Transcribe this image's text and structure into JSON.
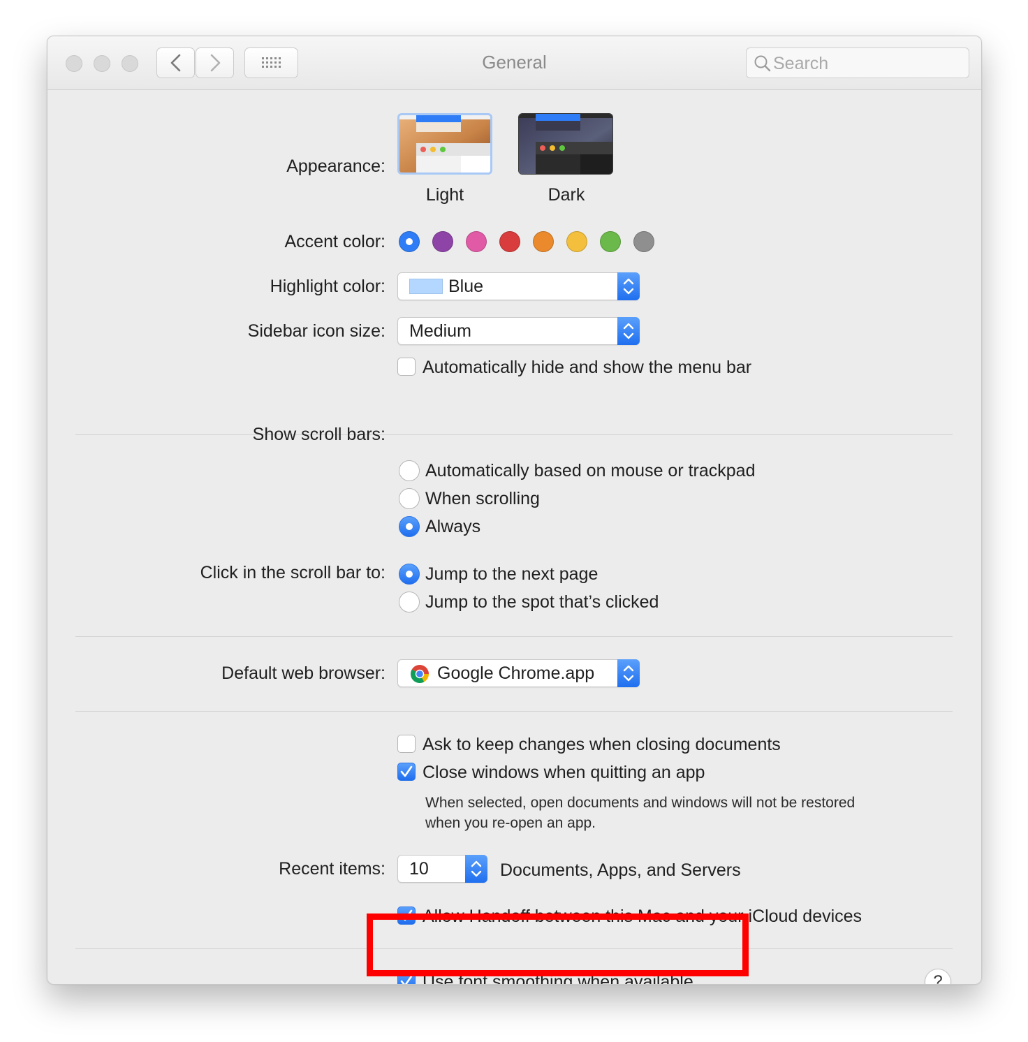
{
  "window": {
    "title": "General"
  },
  "search": {
    "placeholder": "Search"
  },
  "appearance": {
    "label": "Appearance:",
    "options": [
      {
        "name": "Light",
        "selected": true
      },
      {
        "name": "Dark",
        "selected": false
      }
    ]
  },
  "accent": {
    "label": "Accent color:",
    "colors": [
      "#2f7df6",
      "#8e44a6",
      "#e05aa5",
      "#d83c3c",
      "#ea8a2d",
      "#f3bf3c",
      "#6bb94a",
      "#8f8f8f"
    ],
    "selected_index": 0
  },
  "highlight": {
    "label": "Highlight color:",
    "value": "Blue",
    "swatch": "#b3d7ff"
  },
  "sidebar_icon": {
    "label": "Sidebar icon size:",
    "value": "Medium"
  },
  "menu_bar": {
    "label": "Automatically hide and show the menu bar",
    "checked": false
  },
  "scroll_bars": {
    "label": "Show scroll bars:",
    "options": [
      {
        "label": "Automatically based on mouse or trackpad",
        "selected": false
      },
      {
        "label": "When scrolling",
        "selected": false
      },
      {
        "label": "Always",
        "selected": true
      }
    ]
  },
  "scroll_click": {
    "label": "Click in the scroll bar to:",
    "options": [
      {
        "label": "Jump to the next page",
        "selected": true
      },
      {
        "label": "Jump to the spot that’s clicked",
        "selected": false
      }
    ]
  },
  "browser": {
    "label": "Default web browser:",
    "value": "Google Chrome.app",
    "icon": "chrome-icon"
  },
  "documents": {
    "ask_keep": {
      "label": "Ask to keep changes when closing documents",
      "checked": false
    },
    "close_windows": {
      "label": "Close windows when quitting an app",
      "checked": true
    },
    "note_line1": "When selected, open documents and windows will not be restored",
    "note_line2": "when you re-open an app."
  },
  "recent": {
    "label": "Recent items:",
    "value": "10",
    "suffix": "Documents, Apps, and Servers"
  },
  "handoff": {
    "label": "Allow Handoff between this Mac and your iCloud devices",
    "checked": true
  },
  "font_smoothing": {
    "label": "Use font smoothing when available",
    "checked": true
  },
  "help": {
    "label": "?"
  },
  "colors": {
    "accent_blue": "#2f7df6",
    "annotation_red": "#ff0000"
  }
}
